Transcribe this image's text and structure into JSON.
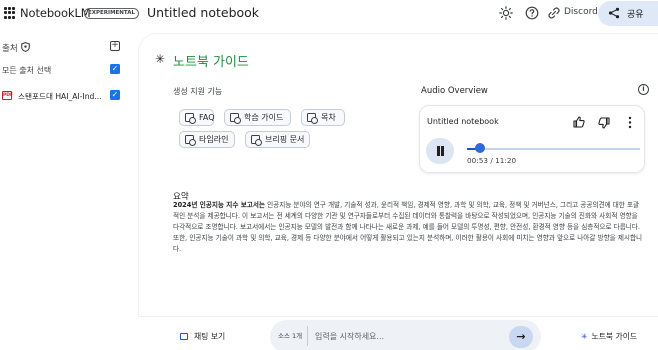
{
  "header": {
    "brand": "NotebookLM",
    "badge": "EXPERIMENTAL",
    "notebook_title": "Untitled notebook",
    "discord_label": "Discord",
    "share_label": "공유"
  },
  "sidebar": {
    "sources_title": "출처",
    "select_all_label": "모든 출처 선택",
    "sources": [
      {
        "icon": "PDF",
        "name": "스탠포드대 HAI_AI-Ind..."
      }
    ]
  },
  "guide": {
    "title": "노트북 가이드",
    "generate_label": "생성 지원 기능",
    "chips": [
      "FAQ",
      "학습 가이드",
      "목차",
      "타임라인",
      "브리핑 문서"
    ]
  },
  "audio": {
    "section_label": "Audio Overview",
    "title": "Untitled notebook",
    "time": "00:53 / 11:20",
    "progress": 0.078
  },
  "summary": {
    "label": "요약",
    "bold_lead": "2024년 인공지능 지수 보고서는",
    "text": " 인공지능 분야의 연구 개발, 기술적 성과, 윤리적 책임, 경제적 영향, 과학 및 의학, 교육, 정책 및 거버넌스, 그리고 공공의견에 대한 포괄적인 분석을 제공합니다. 이 보고서는 전 세계의 다양한 기관 및 연구자들로부터 수집된 데이터와 통찰력을 바탕으로 작성되었으며, 인공지능 기술의 진화와 사회적 영향을 다각적으로 조명합니다. 보고서에서는 인공지능 모델의 발전과 함께 나타나는 새로운 과제, 예를 들어 모델의 투명성, 편향, 안전성, 환경적 영향 등을 심층적으로 다룹니다. 또한, 인공지능 기술이 과학 및 의학, 교육, 경제 등 다양한 분야에서 어떻게 활용되고 있는지 분석하며, 이러한 활용이 사회에 미치는 영향과 앞으로 나아갈 방향을 제시합니다."
  },
  "bottom": {
    "chat_label": "채팅 보기",
    "source_count": "소스 1개",
    "input_placeholder": "입력을 시작하세요...",
    "guide_label": "노트북 가이드"
  },
  "colors": {
    "accent": "#1a73e8",
    "guide_title": "#1e8e3e",
    "share_bg": "#dfe8f7"
  }
}
